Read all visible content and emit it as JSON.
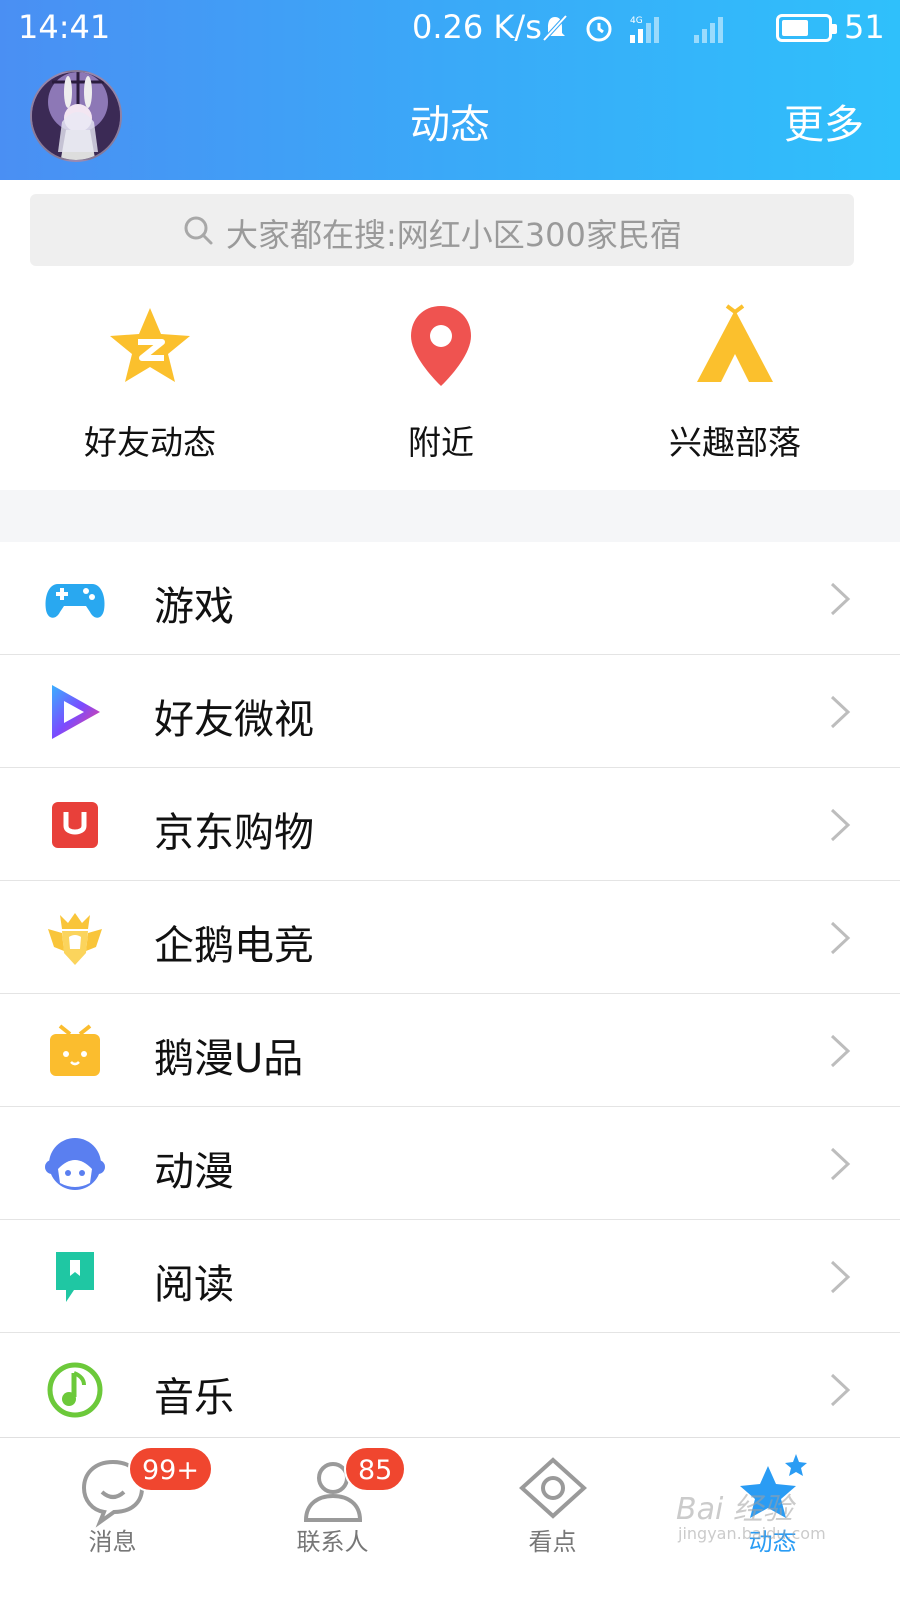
{
  "status_bar": {
    "time": "14:41",
    "net_speed": "0.26 K/s",
    "network": "4G",
    "battery": "51"
  },
  "header": {
    "title": "动态",
    "more": "更多"
  },
  "search": {
    "placeholder": "大家都在搜:网红小区300家民宿"
  },
  "shortcuts": [
    {
      "label": "好友动态",
      "icon": "qzone-star-icon",
      "color": "#fbc02d"
    },
    {
      "label": "附近",
      "icon": "location-pin-icon",
      "color": "#ef5350"
    },
    {
      "label": "兴趣部落",
      "icon": "tent-icon",
      "color": "#fbc02d"
    }
  ],
  "list": [
    {
      "label": "游戏",
      "icon": "gamepad-icon"
    },
    {
      "label": "好友微视",
      "icon": "weishi-play-icon"
    },
    {
      "label": "京东购物",
      "icon": "jd-bag-icon"
    },
    {
      "label": "企鹅电竞",
      "icon": "esports-crest-icon"
    },
    {
      "label": "鹅漫U品",
      "icon": "gift-box-icon"
    },
    {
      "label": "动漫",
      "icon": "anime-face-icon"
    },
    {
      "label": "阅读",
      "icon": "bookmark-icon"
    },
    {
      "label": "音乐",
      "icon": "music-note-icon"
    }
  ],
  "tabs": [
    {
      "label": "消息",
      "badge": "99+",
      "icon": "chat-bubble-icon"
    },
    {
      "label": "联系人",
      "badge": "85",
      "icon": "contacts-icon"
    },
    {
      "label": "看点",
      "icon": "eye-icon"
    },
    {
      "label": "动态",
      "icon": "star-icon",
      "active": true
    }
  ],
  "watermark": {
    "line1": "Bai 经验",
    "line2": "jingyan.baidu.com"
  },
  "colors": {
    "header_start": "#4a8ff3",
    "header_end": "#2fc0fb",
    "badge": "#f0462f",
    "active_tab": "#2a9cf4"
  }
}
